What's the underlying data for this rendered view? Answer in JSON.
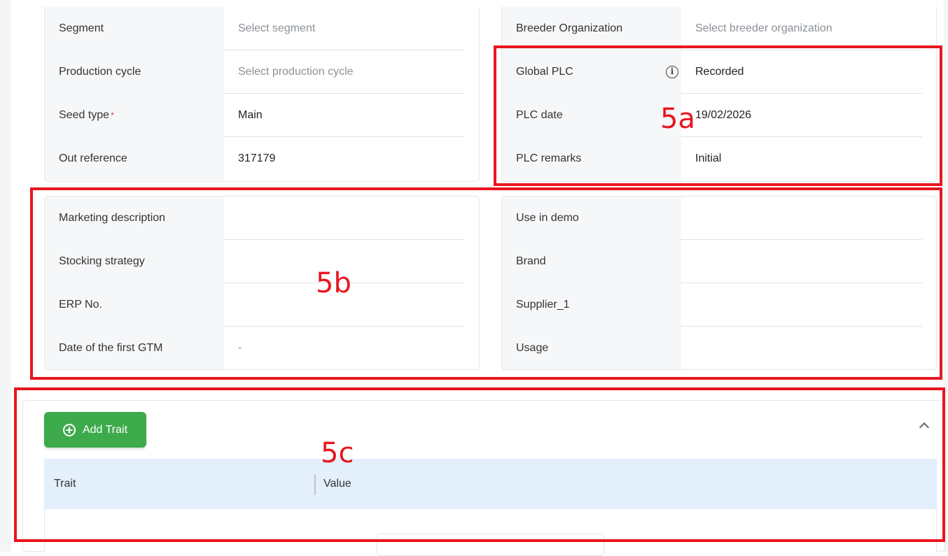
{
  "left_card_top": {
    "rows": [
      {
        "label": "Segment",
        "value": "Select segment",
        "placeholder": true
      },
      {
        "label": "Production cycle",
        "value": "Select production cycle",
        "placeholder": true
      },
      {
        "label": "Seed type",
        "required_mark": "*",
        "value": "Main"
      },
      {
        "label": "Out reference",
        "value": "317179"
      }
    ]
  },
  "right_card_top": {
    "rows": [
      {
        "label": "Breeder Organization",
        "value": "Select breeder organization",
        "placeholder": true
      },
      {
        "label": "Global PLC",
        "icon": "info-icon",
        "value": "Recorded"
      },
      {
        "label": "PLC date",
        "value": "19/02/2026"
      },
      {
        "label": "PLC remarks",
        "value": "Initial"
      }
    ]
  },
  "left_card_bottom": {
    "rows": [
      {
        "label": "Marketing description",
        "value": ""
      },
      {
        "label": "Stocking strategy",
        "value": ""
      },
      {
        "label": "ERP No.",
        "value": ""
      },
      {
        "label": "Date of the first GTM",
        "value": "-"
      }
    ]
  },
  "right_card_bottom": {
    "rows": [
      {
        "label": "Use in demo",
        "value": ""
      },
      {
        "label": "Brand",
        "value": ""
      },
      {
        "label": "Supplier_1",
        "value": ""
      },
      {
        "label": "Usage",
        "value": ""
      }
    ]
  },
  "annotations": {
    "a": "5a",
    "b": "5b",
    "c": "5c",
    "color": "#e8161f"
  },
  "traits": {
    "add_button_label": "Add Trait",
    "add_button_icon": "plus-circle-icon",
    "collapse_icon": "chevron-up-icon",
    "columns": [
      "Trait",
      "Value"
    ]
  },
  "colors": {
    "accent_green": "#3daa4b",
    "table_header_bg": "#e3effb",
    "required": "#e53935"
  }
}
